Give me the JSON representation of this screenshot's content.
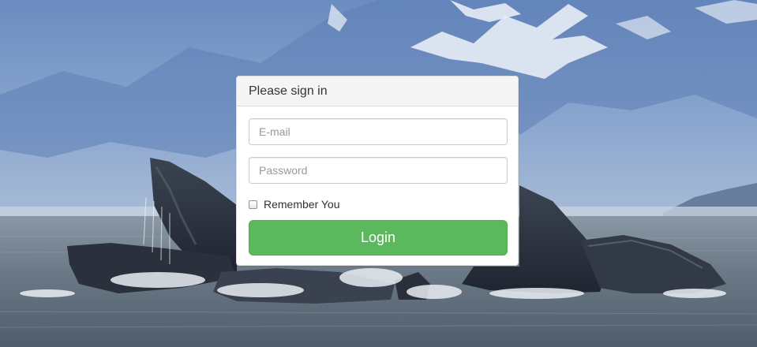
{
  "login_panel": {
    "title": "Please sign in",
    "email": {
      "placeholder": "E-mail",
      "value": ""
    },
    "password": {
      "placeholder": "Password",
      "value": ""
    },
    "remember": {
      "label": "Remember You",
      "checked": false
    },
    "submit_label": "Login"
  },
  "colors": {
    "button": "#5cb85c",
    "panel_heading": "#f5f5f5",
    "sky": "#7f9dc6",
    "water": "#5f6e7d"
  },
  "background": {
    "subject": "humpback whales lunge feeding in front of snowy mountains"
  }
}
